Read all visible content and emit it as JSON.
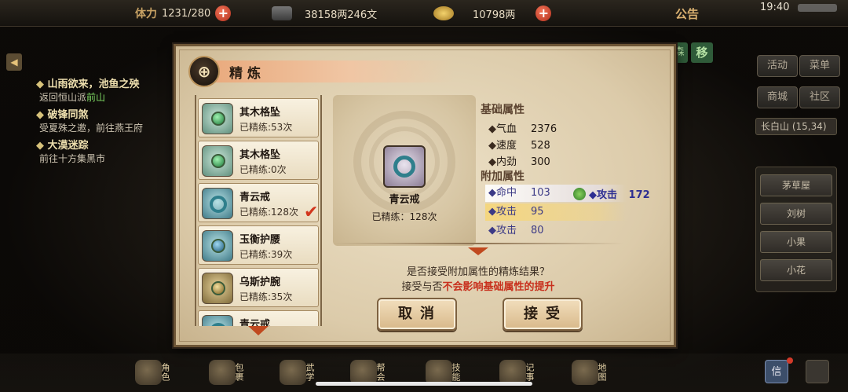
{
  "topbar": {
    "stamina_label": "体力",
    "stamina_value": "1231/280",
    "silver_value": "38158两246文",
    "gold_value": "10798两",
    "notice_label": "公告",
    "time": "19:40"
  },
  "quest_log": {
    "items": [
      {
        "title": "山雨欲来，池鱼之殃",
        "desc_pre": "返回恒山派",
        "desc_highlight": "前山"
      },
      {
        "title": "破锋同煞",
        "desc_pre": "受夏殊之邀，前往燕王府",
        "desc_highlight": ""
      },
      {
        "title": "大漠迷踪",
        "desc_pre": "前往十方集黑市",
        "desc_highlight": ""
      }
    ]
  },
  "right_menu": {
    "buttons": [
      "活动",
      "菜单",
      "商城",
      "社区"
    ],
    "location": "长白山 (15,34)",
    "npcs": [
      "茅草屋",
      "刘树",
      "小果",
      "小花"
    ],
    "side_move": "移"
  },
  "bottom_bar": {
    "items": [
      "角色",
      "包裹",
      "武学",
      "帮会",
      "技能",
      "记事",
      "地图"
    ],
    "info_label": "信"
  },
  "modal": {
    "title": "精炼",
    "emblem": "⊕",
    "items": [
      {
        "name": "其木格坠",
        "count": "已精练:53次",
        "icon": "green-pendant"
      },
      {
        "name": "其木格坠",
        "count": "已精练:0次",
        "icon": "green-pendant"
      },
      {
        "name": "青云戒",
        "count": "已精练:128次",
        "icon": "teal-ring",
        "selected": true
      },
      {
        "name": "玉衡护腰",
        "count": "已精练:39次",
        "icon": "teal-belt"
      },
      {
        "name": "乌斯护腕",
        "count": "已精练:35次",
        "icon": "gold-bracer"
      },
      {
        "name": "青云戒",
        "count": "",
        "icon": "teal-ring"
      }
    ],
    "selected": {
      "name": "青云戒",
      "count": "已精练：128次"
    },
    "base_header": "基础属性",
    "base_attrs": [
      {
        "name": "气血",
        "value": "2376"
      },
      {
        "name": "速度",
        "value": "528"
      },
      {
        "name": "内劲",
        "value": "300"
      }
    ],
    "extra_header": "附加属性",
    "extra_attrs": [
      {
        "name": "命中",
        "value": "103",
        "state": "selected"
      },
      {
        "name": "攻击",
        "value": "95",
        "state": "highlight"
      },
      {
        "name": "攻击",
        "value": "80",
        "state": "normal"
      }
    ],
    "swap_result": {
      "name": "攻击",
      "value": "172"
    },
    "prompt_line1": "是否接受附加属性的精炼结果？",
    "prompt_line2_pre": "接受与否",
    "prompt_line2_red": "不会影响基础属性的提升",
    "cancel_label": "取消",
    "accept_label": "接受"
  },
  "colors": {
    "accent_red": "#c8301d",
    "extra_attr_blue": "#3c3a86",
    "highlight_gold": "#f6d678"
  }
}
